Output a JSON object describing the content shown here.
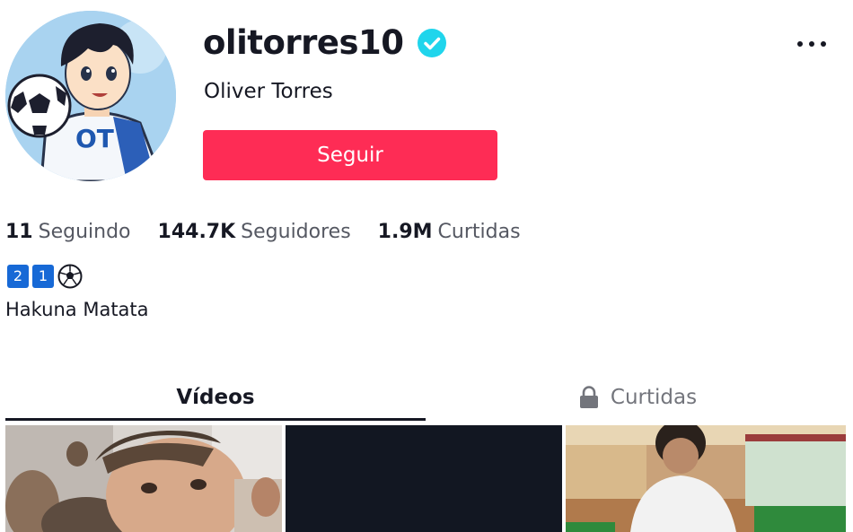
{
  "profile": {
    "username": "olitorres10",
    "display_name": "Oliver Torres",
    "verified": true,
    "avatar_jersey_text": "OT",
    "follow_label": "Seguir",
    "colors": {
      "follow_button": "#fe2c55",
      "verified_badge": "#20d5ec"
    }
  },
  "stats": [
    {
      "value": "11",
      "label": "Seguindo"
    },
    {
      "value": "144.7K",
      "label": "Seguidores"
    },
    {
      "value": "1.9M",
      "label": "Curtidas"
    }
  ],
  "bio": {
    "emoji": {
      "keycap_1": "2",
      "keycap_2": "1",
      "ball": "soccer-ball-icon"
    },
    "text": "Hakuna Matata"
  },
  "tabs": [
    {
      "label": "Vídeos",
      "active": true
    },
    {
      "label": "Curtidas",
      "active": false,
      "icon": "lock-icon"
    }
  ],
  "videos": [
    {
      "thumb": "photo-selfie-locker-room"
    },
    {
      "thumb": "dark-blank"
    },
    {
      "thumb": "photo-man-white-shirt"
    }
  ]
}
